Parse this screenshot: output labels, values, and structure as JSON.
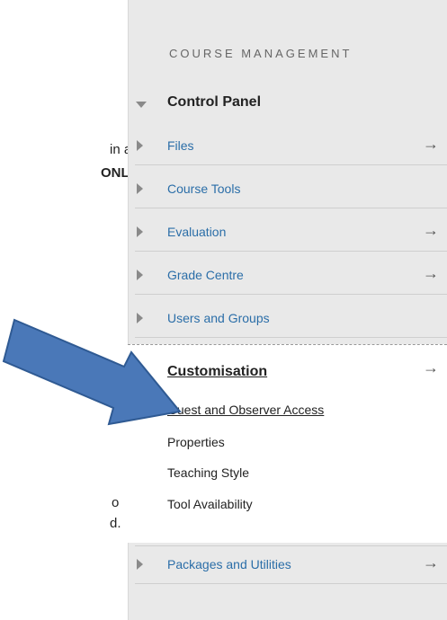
{
  "document": {
    "fragment1": "in any",
    "fragment2": "ONLY",
    "fragment3": "o",
    "fragment4": "d."
  },
  "panel": {
    "heading": "COURSE MANAGEMENT",
    "control_panel": "Control Panel",
    "items": [
      {
        "label": "Files",
        "arrow": "→"
      },
      {
        "label": "Course Tools",
        "arrow": ""
      },
      {
        "label": "Evaluation",
        "arrow": "→"
      },
      {
        "label": "Grade Centre",
        "arrow": "→"
      },
      {
        "label": "Users and Groups",
        "arrow": ""
      }
    ],
    "customisation": {
      "title": "Customisation",
      "arrow": "→",
      "subitems": [
        "Guest and Observer Access",
        "Properties",
        "Teaching Style",
        "Tool Availability"
      ]
    },
    "packages": {
      "label": "Packages and Utilities",
      "arrow": "→"
    }
  },
  "colors": {
    "panel_bg": "#e9e9e9",
    "link": "#2b6ea8",
    "callout_arrow": "#4a78b8"
  }
}
